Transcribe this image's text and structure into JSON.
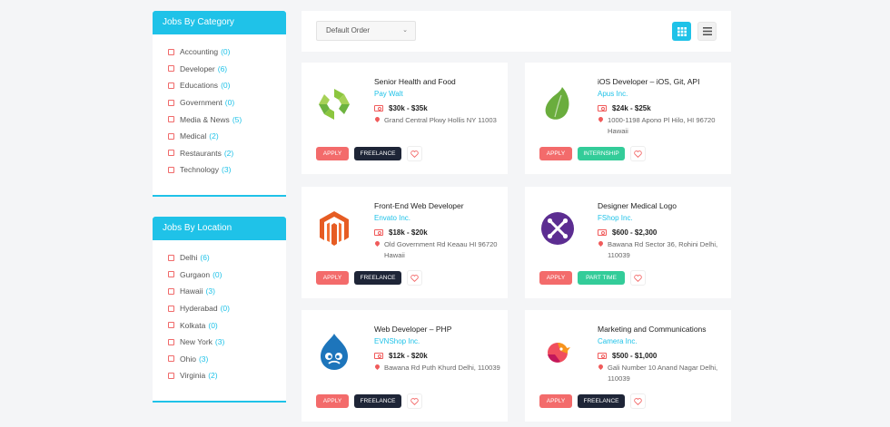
{
  "category_widget": {
    "title": "Jobs By Category",
    "items": [
      {
        "label": "Accounting",
        "count": "(0)"
      },
      {
        "label": "Developer",
        "count": "(6)"
      },
      {
        "label": "Educations",
        "count": "(0)"
      },
      {
        "label": "Government",
        "count": "(0)"
      },
      {
        "label": "Media & News",
        "count": "(5)"
      },
      {
        "label": "Medical",
        "count": "(2)"
      },
      {
        "label": "Restaurants",
        "count": "(2)"
      },
      {
        "label": "Technology",
        "count": "(3)"
      }
    ]
  },
  "location_widget": {
    "title": "Jobs By Location",
    "items": [
      {
        "label": "Delhi",
        "count": "(6)"
      },
      {
        "label": "Gurgaon",
        "count": "(0)"
      },
      {
        "label": "Hawaii",
        "count": "(3)"
      },
      {
        "label": "Hyderabad",
        "count": "(0)"
      },
      {
        "label": "Kolkata",
        "count": "(0)"
      },
      {
        "label": "New York",
        "count": "(3)"
      },
      {
        "label": "Ohio",
        "count": "(3)"
      },
      {
        "label": "Virginia",
        "count": "(2)"
      }
    ]
  },
  "toolbar": {
    "sort_value": "Default Order",
    "grid_icon": "grid-view-icon",
    "list_icon": "list-view-icon"
  },
  "colors": {
    "accent": "#1fc2e8",
    "apply": "#f36b6b",
    "freelance": "#1e2537",
    "internship": "#33cc99",
    "part_time": "#33cc99"
  },
  "jobs": [
    {
      "title": "Senior Health and Food",
      "company": "Pay Walt",
      "salary": "$30k - $35k",
      "address": "Grand Central Pkwy Hollis NY 11003",
      "type": "FREELANCE",
      "logo": "health-logo-icon",
      "apply": "APPLY"
    },
    {
      "title": "iOS Developer – iOS, Git, API",
      "company": "Apus Inc.",
      "salary": "$24k - $25k",
      "address": "1000-1198 Apono Pl Hilo, HI 96720 Hawaii",
      "type": "INTERNSHIP",
      "logo": "leaf-logo-icon",
      "apply": "APPLY"
    },
    {
      "title": "Front-End Web Developer",
      "company": "Envato Inc.",
      "salary": "$18k - $20k",
      "address": "Old Government Rd Keaau HI 96720 Hawaii",
      "type": "FREELANCE",
      "logo": "magento-logo-icon",
      "apply": "APPLY"
    },
    {
      "title": "Designer Medical Logo",
      "company": "FShop Inc.",
      "salary": "$600 - $2,300",
      "address": "Bawana Rd Sector 36, Rohini Delhi, 110039",
      "type": "PART TIME",
      "logo": "joomla-logo-icon",
      "apply": "APPLY"
    },
    {
      "title": "Web Developer – PHP",
      "company": "EVNShop Inc.",
      "salary": "$12k - $20k",
      "address": "Bawana Rd Puth Khurd Delhi, 110039",
      "type": "FREELANCE",
      "logo": "drupal-logo-icon",
      "apply": "APPLY"
    },
    {
      "title": "Marketing and Communications",
      "company": "Camera Inc.",
      "salary": "$500 - $1,000",
      "address": "Gali Number 10 Anand Nagar Delhi, 110039",
      "type": "FREELANCE",
      "logo": "bird-logo-icon",
      "apply": "APPLY"
    }
  ]
}
